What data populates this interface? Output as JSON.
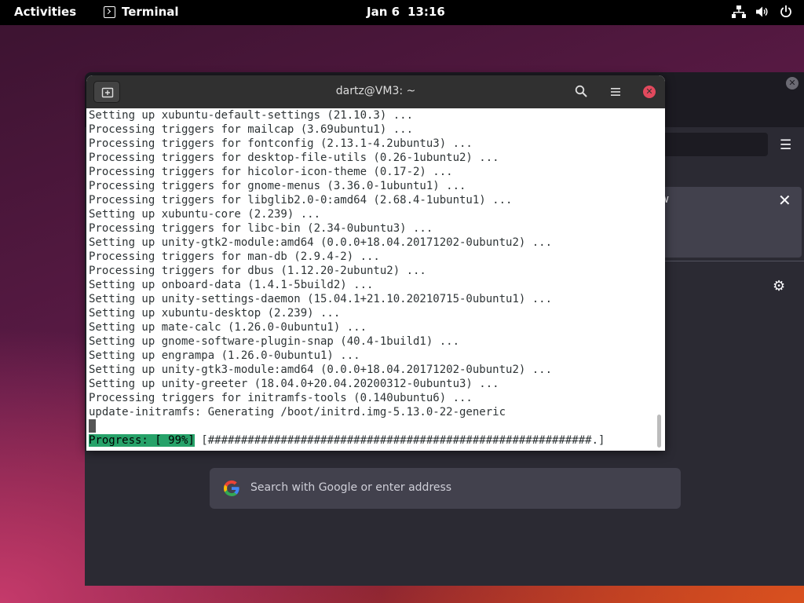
{
  "topbar": {
    "activities": "Activities",
    "app_name": "Terminal",
    "date": "Jan 6",
    "time": "13:16"
  },
  "icons": {
    "network": "network-wired-icon",
    "volume": "volume-icon",
    "power": "power-icon",
    "terminal_app": "terminal-icon"
  },
  "terminal": {
    "title": "dartz@VM3: ~",
    "lines": [
      "Setting up xubuntu-default-settings (21.10.3) ...",
      "Processing triggers for mailcap (3.69ubuntu1) ...",
      "Processing triggers for fontconfig (2.13.1-4.2ubuntu3) ...",
      "Processing triggers for desktop-file-utils (0.26-1ubuntu2) ...",
      "Processing triggers for hicolor-icon-theme (0.17-2) ...",
      "Processing triggers for gnome-menus (3.36.0-1ubuntu1) ...",
      "Processing triggers for libglib2.0-0:amd64 (2.68.4-1ubuntu1) ...",
      "Setting up xubuntu-core (2.239) ...",
      "Processing triggers for libc-bin (2.34-0ubuntu3) ...",
      "Setting up unity-gtk2-module:amd64 (0.0.0+18.04.20171202-0ubuntu2) ...",
      "Processing triggers for man-db (2.9.4-2) ...",
      "Processing triggers for dbus (1.12.20-2ubuntu2) ...",
      "Setting up onboard-data (1.4.1-5build2) ...",
      "Setting up unity-settings-daemon (15.04.1+21.10.20210715-0ubuntu1) ...",
      "Setting up xubuntu-desktop (2.239) ...",
      "Setting up mate-calc (1.26.0-0ubuntu1) ...",
      "Setting up gnome-software-plugin-snap (40.4-1build1) ...",
      "Setting up engrampa (1.26.0-0ubuntu1) ...",
      "Setting up unity-gtk3-module:amd64 (0.0.0+18.04.20171202-0ubuntu2) ...",
      "Setting up unity-greeter (18.04.0+20.04.20200312-0ubuntu3) ...",
      "Processing triggers for initramfs-tools (0.140ubuntu6) ...",
      "update-initramfs: Generating /boot/initrd.img-5.13.0-22-generic"
    ],
    "progress_label": "Progress: [ 99%]",
    "progress_bar": " [##########################################################.]",
    "progress_percent": 99
  },
  "browser": {
    "search_placeholder": "Search with Google or enter address",
    "notice_text": "ew"
  },
  "colors": {
    "progress_bg": "#26a269",
    "close_button": "#e2495d",
    "terminal_header": "#303030"
  }
}
